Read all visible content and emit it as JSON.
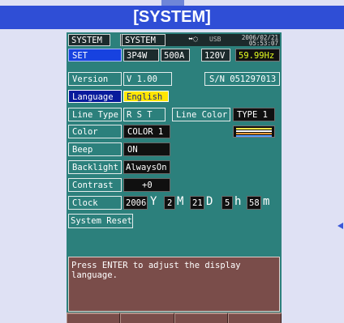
{
  "banner": {
    "title": "[SYSTEM]"
  },
  "header": {
    "mode1": "SYSTEM",
    "mode2": "SYSTEM",
    "signal_icon_text": "⬌◌",
    "usb": "USB",
    "date": "2006/02/21",
    "time": "05:53:07"
  },
  "status": {
    "tab": "SET",
    "wiring": "3P4W",
    "current_range": "500A",
    "voltage_range": "120V",
    "frequency": "59.99Hz"
  },
  "rows": {
    "version": {
      "label": "Version",
      "value": "V 1.00",
      "serial": "S/N 051297013"
    },
    "language": {
      "label": "Language",
      "value": "English"
    },
    "line_type": {
      "label": "Line Type",
      "value": "R S T",
      "line_color_label": "Line Color",
      "line_color_value": "TYPE 1"
    },
    "color": {
      "label": "Color",
      "value": "COLOR 1"
    },
    "beep": {
      "label": "Beep",
      "value": "ON"
    },
    "backlight": {
      "label": "Backlight",
      "value": "AlwaysOn"
    },
    "contrast": {
      "label": "Contrast",
      "value": "+0"
    },
    "clock": {
      "label": "Clock",
      "year": "2006",
      "year_unit": "Y",
      "month": "2",
      "month_unit": "M",
      "day": "21",
      "day_unit": "D",
      "hour": "5",
      "hour_unit": "h",
      "minute": "58",
      "minute_unit": "m"
    },
    "system_reset": {
      "label": "System Reset"
    }
  },
  "message": "Press ENTER to adjust the display\nlanguage.",
  "colors": {
    "screen": "#2c807c",
    "banner": "#2f4ed6",
    "highlight": "#ffe600",
    "line_colors": [
      "#f4e64a",
      "#ffffff",
      "#e89a3a",
      "#5aa0ff"
    ]
  }
}
